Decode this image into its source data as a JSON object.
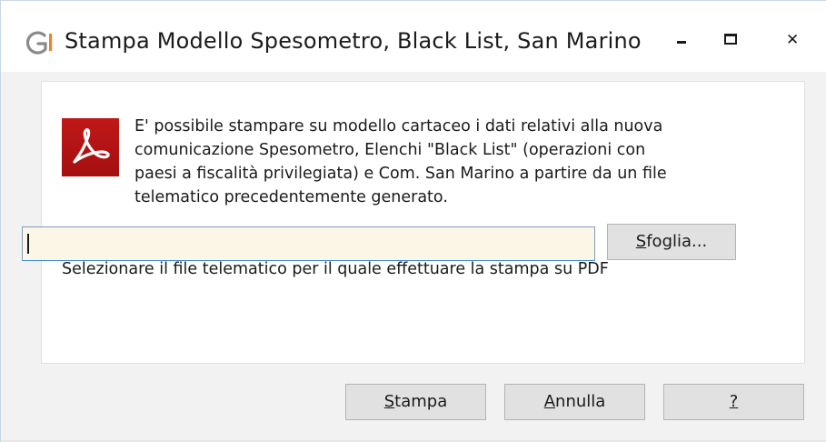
{
  "window": {
    "title": "Stampa Modello Spesometro, Black List, San Marino",
    "app_icon": "g-logo-icon",
    "controls": {
      "minimize_icon": "minimize-icon",
      "maximize_icon": "maximize-icon",
      "close_icon": "close-icon",
      "close_glyph": "✕"
    },
    "colors": {
      "logo_orange": "#e8852a",
      "logo_gray": "#8a8a8a",
      "pdf_red": "#b31214",
      "input_bg": "#fbf6e6",
      "input_border": "#3b8ad9"
    }
  },
  "content": {
    "pdf_icon": "acrobat-pdf-icon",
    "description": "E' possibile stampare su modello cartaceo i dati relativi alla nuova\ncomunicazione Spesometro, Elenchi \"Black List\" (operazioni con\npaesi a fiscalità privilegiata) e Com. San Marino a partire da un file\ntelematico precedentemente generato.",
    "select_label": "Selezionare il file telematico per il quale effettuare la stampa su PDF",
    "file_input": {
      "value": "",
      "placeholder": ""
    },
    "browse_button": {
      "accel": "S",
      "rest": "foglia..."
    }
  },
  "buttons": {
    "print": {
      "accel": "S",
      "rest": "tampa"
    },
    "cancel": {
      "accel": "A",
      "rest": "nnulla"
    },
    "help": {
      "accel": "?",
      "rest": ""
    }
  }
}
